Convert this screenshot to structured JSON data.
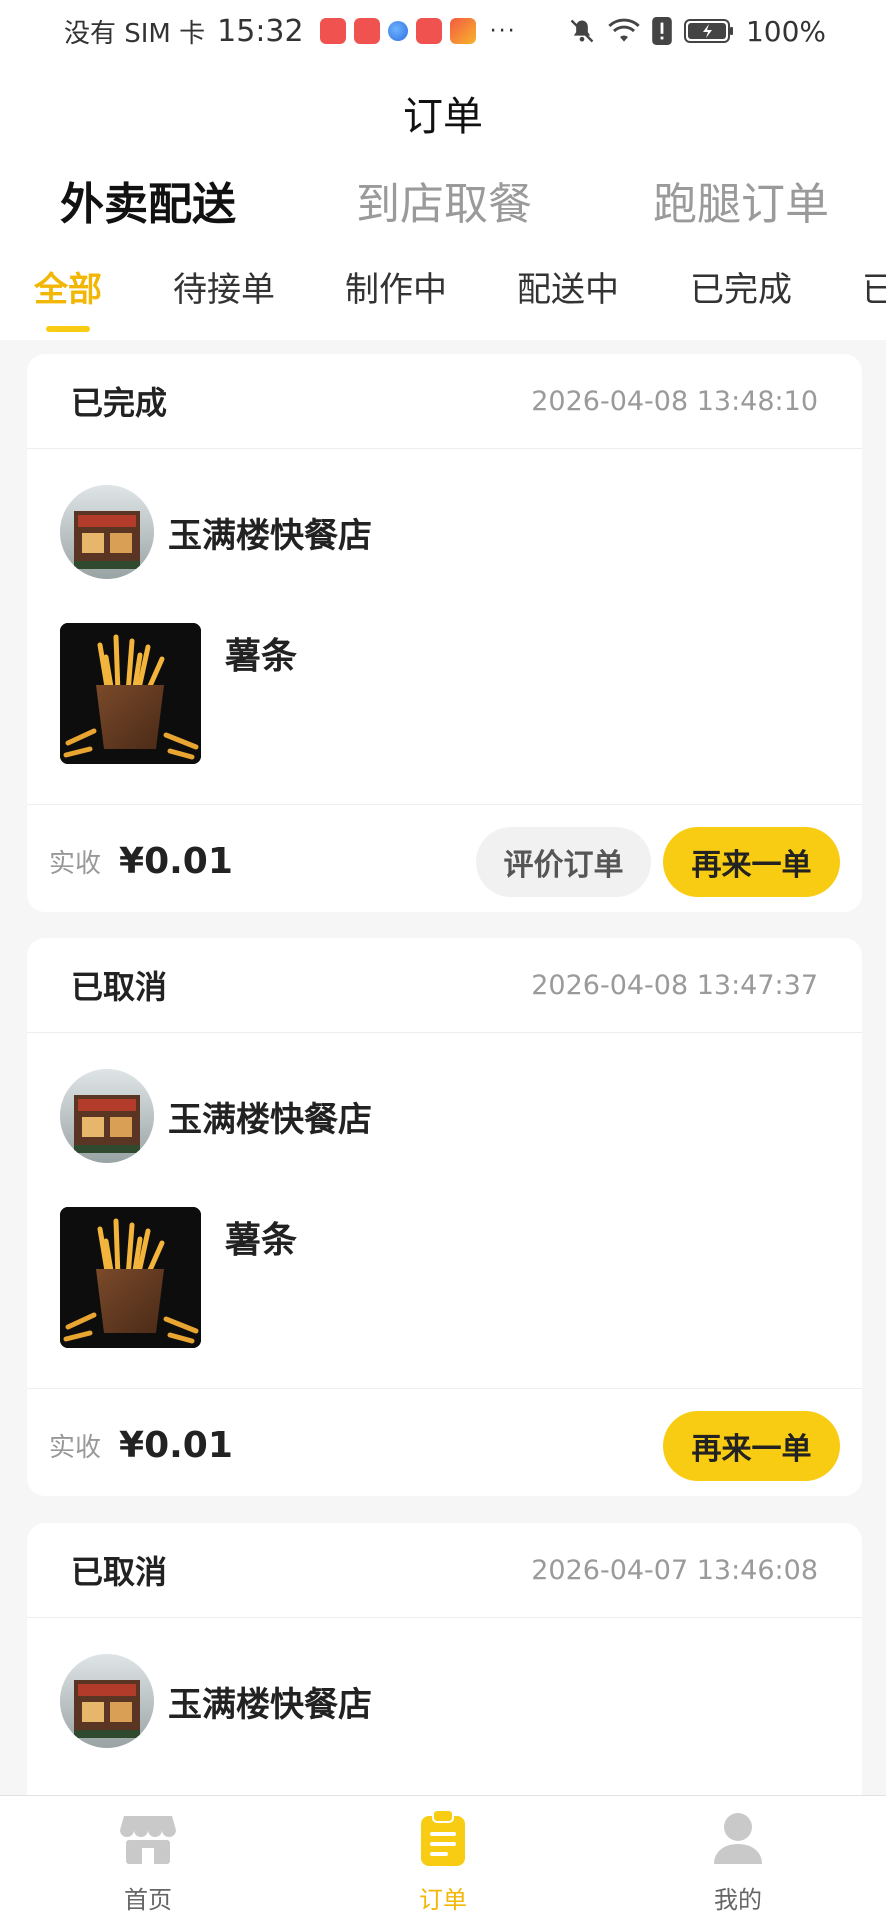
{
  "status_bar": {
    "carrier": "没有 SIM 卡",
    "time": "15:32",
    "more": "···",
    "battery": "100%",
    "icons": [
      "shopping-app-icon",
      "shopping-app-icon",
      "browser-icon",
      "shopping-app-icon",
      "video-app-icon",
      "silent-bell-icon",
      "wifi-icon",
      "alert-icon",
      "battery-charging-icon"
    ]
  },
  "header": {
    "title": "订单"
  },
  "main_tabs": [
    {
      "label": "外卖配送",
      "active": true
    },
    {
      "label": "到店取餐",
      "active": false
    },
    {
      "label": "跑腿订单",
      "active": false
    }
  ],
  "status_tabs": [
    {
      "label": "全部",
      "active": true
    },
    {
      "label": "待接单",
      "active": false
    },
    {
      "label": "制作中",
      "active": false
    },
    {
      "label": "配送中",
      "active": false
    },
    {
      "label": "已完成",
      "active": false
    },
    {
      "label": "已",
      "active": false
    }
  ],
  "orders": [
    {
      "status": "已完成",
      "time": "2026-04-08 13:48:10",
      "shop": "玉满楼快餐店",
      "item": "薯条",
      "pay_label": "实收",
      "amount": "¥0.01",
      "actions": [
        "评价订单",
        "再来一单"
      ]
    },
    {
      "status": "已取消",
      "time": "2026-04-08 13:47:37",
      "shop": "玉满楼快餐店",
      "item": "薯条",
      "pay_label": "实收",
      "amount": "¥0.01",
      "actions": [
        "再来一单"
      ]
    },
    {
      "status": "已取消",
      "time": "2026-04-07 13:46:08",
      "shop": "玉满楼快餐店"
    }
  ],
  "bottom_nav": [
    {
      "label": "首页",
      "icon": "store-icon",
      "active": false
    },
    {
      "label": "订单",
      "icon": "clipboard-icon",
      "active": true
    },
    {
      "label": "我的",
      "icon": "user-icon",
      "active": false
    }
  ],
  "colors": {
    "accent": "#f7cc12",
    "accent_text": "#f2b705",
    "background": "#f6f6f6"
  }
}
